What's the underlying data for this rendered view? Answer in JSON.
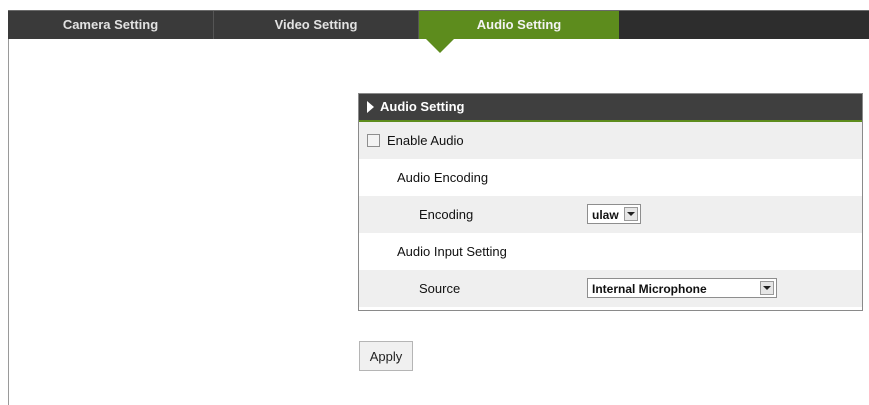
{
  "tabs": [
    {
      "label": "Camera Setting"
    },
    {
      "label": "Video Setting"
    },
    {
      "label": "Audio Setting",
      "active": true
    }
  ],
  "panel": {
    "title": "Audio Setting",
    "enable_audio": {
      "label": "Enable Audio",
      "checked": false
    },
    "audio_encoding_heading": "Audio Encoding",
    "encoding": {
      "label": "Encoding",
      "value": "ulaw"
    },
    "audio_input_heading": "Audio Input Setting",
    "source": {
      "label": "Source",
      "value": "Internal Microphone"
    }
  },
  "apply_label": "Apply",
  "colors": {
    "accent": "#5d8c1d",
    "tabbar": "#2d2d2d",
    "panel_header": "#3f3f3f"
  }
}
